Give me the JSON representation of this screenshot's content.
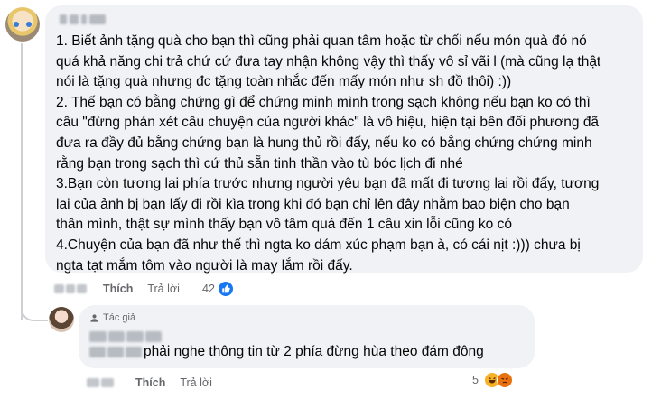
{
  "comment": {
    "lines": [
      "1. Biết ảnh tặng quà cho bạn thì cũng phải quan tâm hoặc từ chối nếu món quà đó nó",
      "quá khả năng chi trả chứ cứ đưa tay nhận không vậy thì thấy vô sỉ vãi l (mà cũng lạ thật",
      "nói là tặng quà nhưng đc tặng toàn nhắc đến mấy món như sh đồ thôi) :))",
      "2. Thế bạn có bằng chứng gì để chứng minh mình trong sạch không nếu bạn ko có thì",
      "câu \"đừng phán xét câu chuyện của người khác\" là vô hiệu, hiện tại bên đối phương đã",
      "đưa ra đầy đủ bằng chứng bạn là hung thủ rồi đấy, nếu ko có bằng chứng chứng minh",
      "rằng bạn trong sạch thì cứ thủ sẵn tinh thần vào tù bóc lịch đi nhé",
      "3.Bạn còn tương lai phía trước nhưng người yêu bạn đã mất đi tương lai rồi đấy, tương",
      "lai của ảnh bị bạn lấy đi rồi kìa trong khi đó bạn chỉ lên đây nhằm bao biện cho bạn",
      "thân mình, thật sự mình thấy bạn vô tâm quá đến 1 câu xin lỗi cũng ko có",
      "4.Chuyện của bạn đã như thế thì ngta ko dám xúc phạm bạn à, có cái nịt :))) chưa bị",
      "ngta tạt mắm tôm vào người là may lắm rồi đấy."
    ],
    "like_label": "Thích",
    "reply_label": "Trả lời",
    "reaction_count": "42"
  },
  "reply": {
    "author_tag": "Tác giả",
    "text": "phải nghe thông tin từ 2 phía đừng hùa theo đám đông",
    "like_label": "Thích",
    "reply_label": "Trả lời",
    "reaction_count": "5"
  },
  "colors": {
    "bubble_bg": "#f0f2f5",
    "meta_text": "#65676b",
    "like_blue": "#1877f2",
    "haha_yellow": "#f7b125",
    "angry_orange": "#e9710f"
  },
  "icons": [
    "like-icon",
    "haha-icon",
    "angry-icon",
    "author-tag-icon"
  ]
}
